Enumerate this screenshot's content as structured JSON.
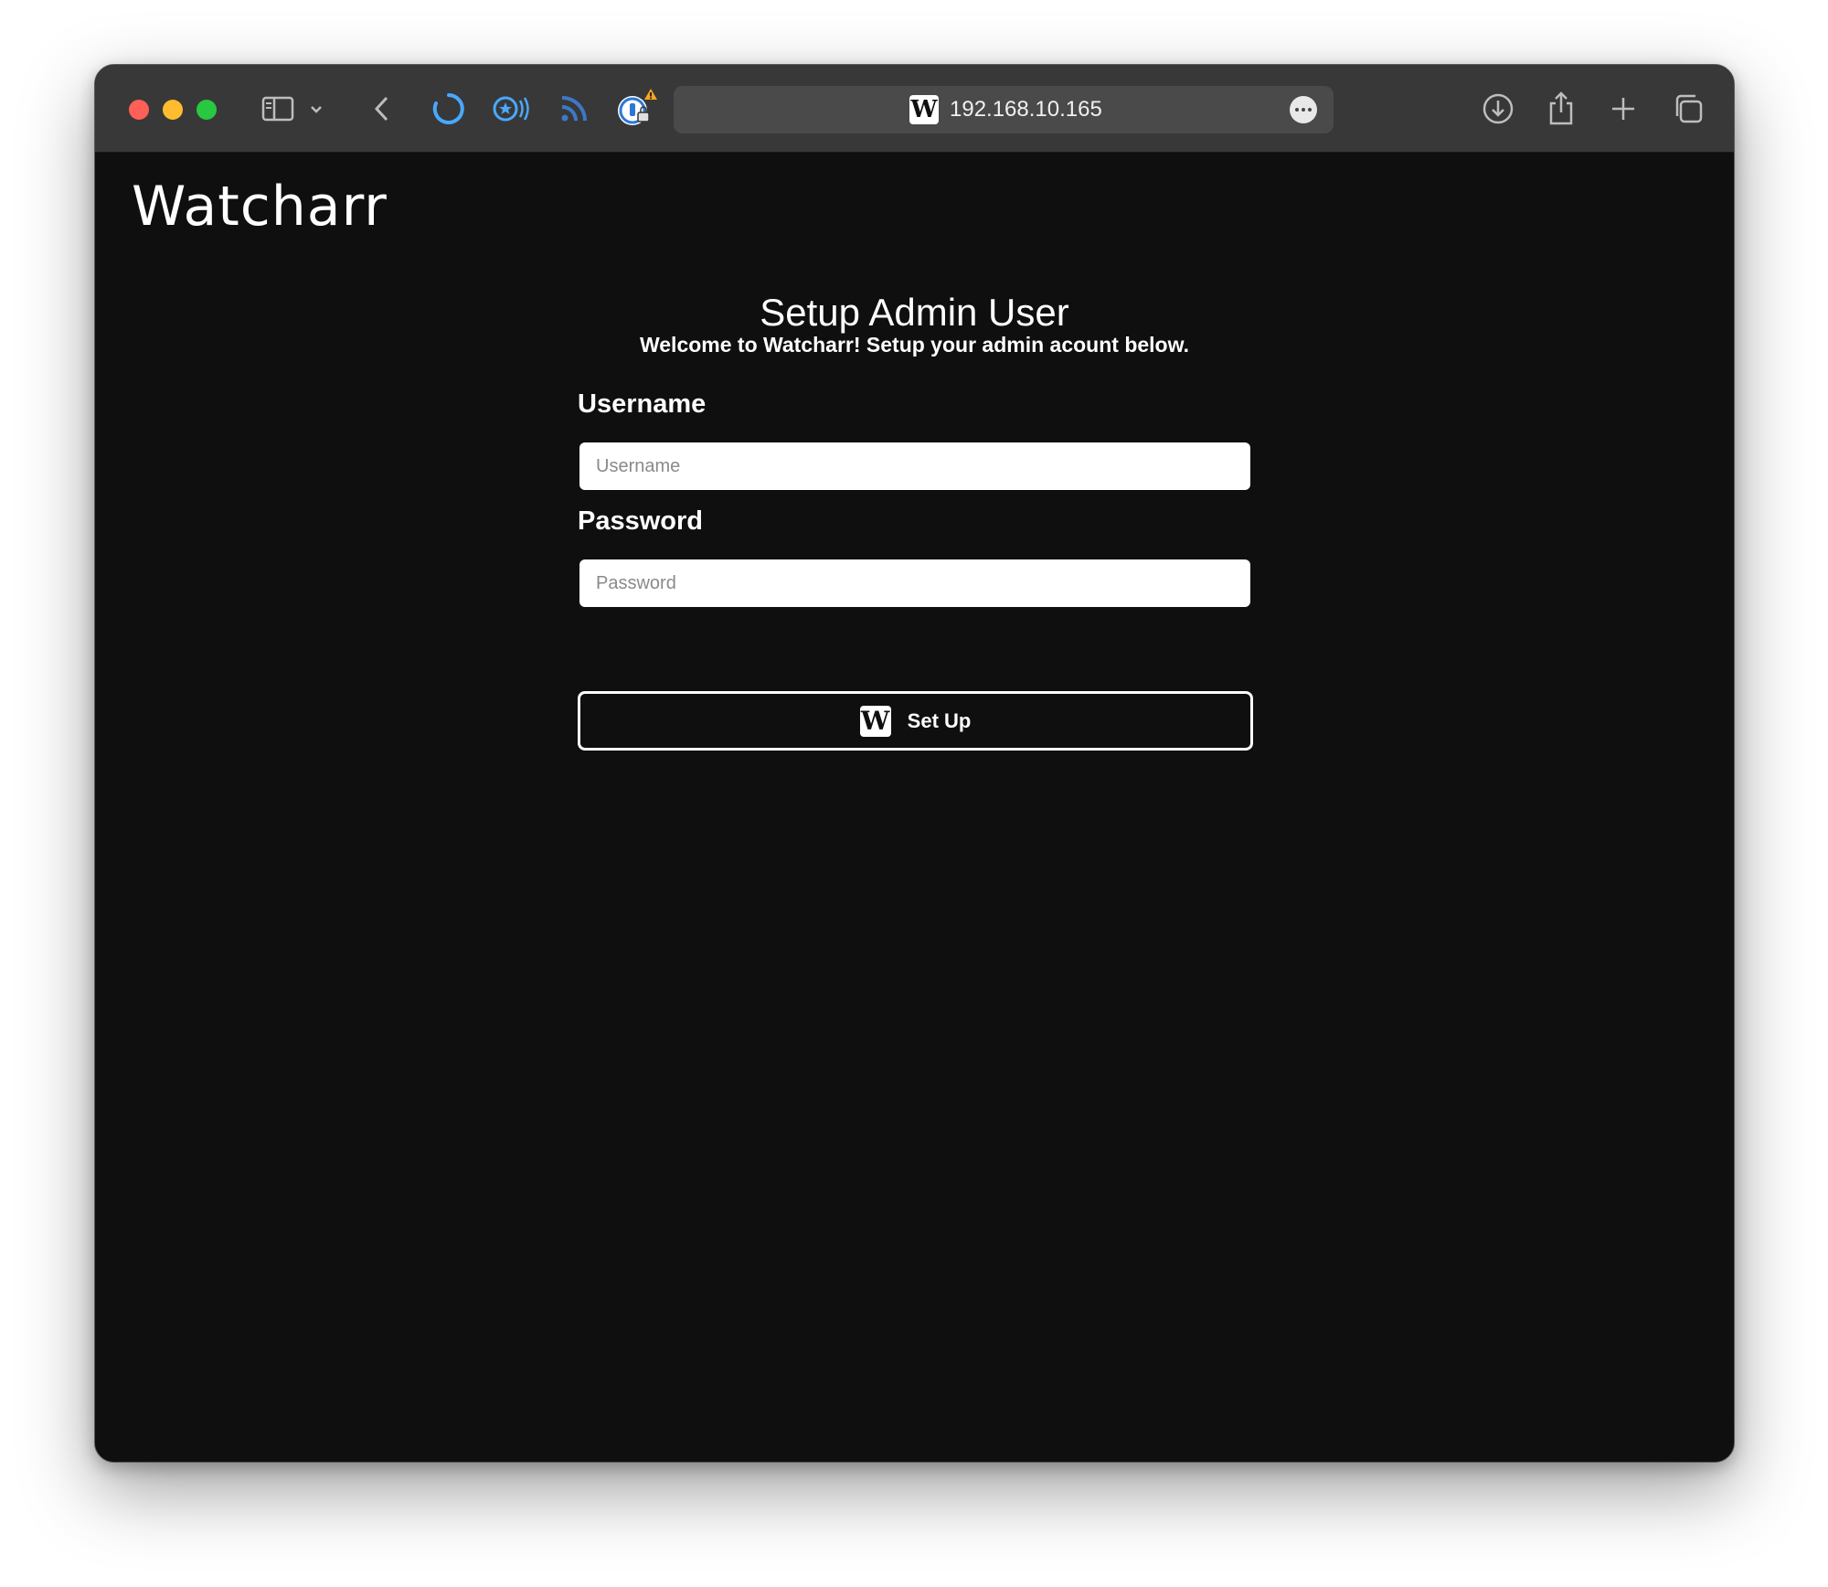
{
  "browser": {
    "url": "192.168.10.165",
    "favicon_glyph": "W"
  },
  "app": {
    "logo": "Watcharr"
  },
  "setup": {
    "title": "Setup Admin User",
    "subtitle": "Welcome to Watcharr! Setup your admin acount below.",
    "username_label": "Username",
    "username_placeholder": "Username",
    "password_label": "Password",
    "password_placeholder": "Password",
    "button_label": "Set Up",
    "button_icon_glyph": "W"
  },
  "colors": {
    "page_bg": "#0f0f0f",
    "titlebar_bg": "#383838",
    "accent_blue": "#4aa8ff",
    "warning": "#f5a623"
  }
}
